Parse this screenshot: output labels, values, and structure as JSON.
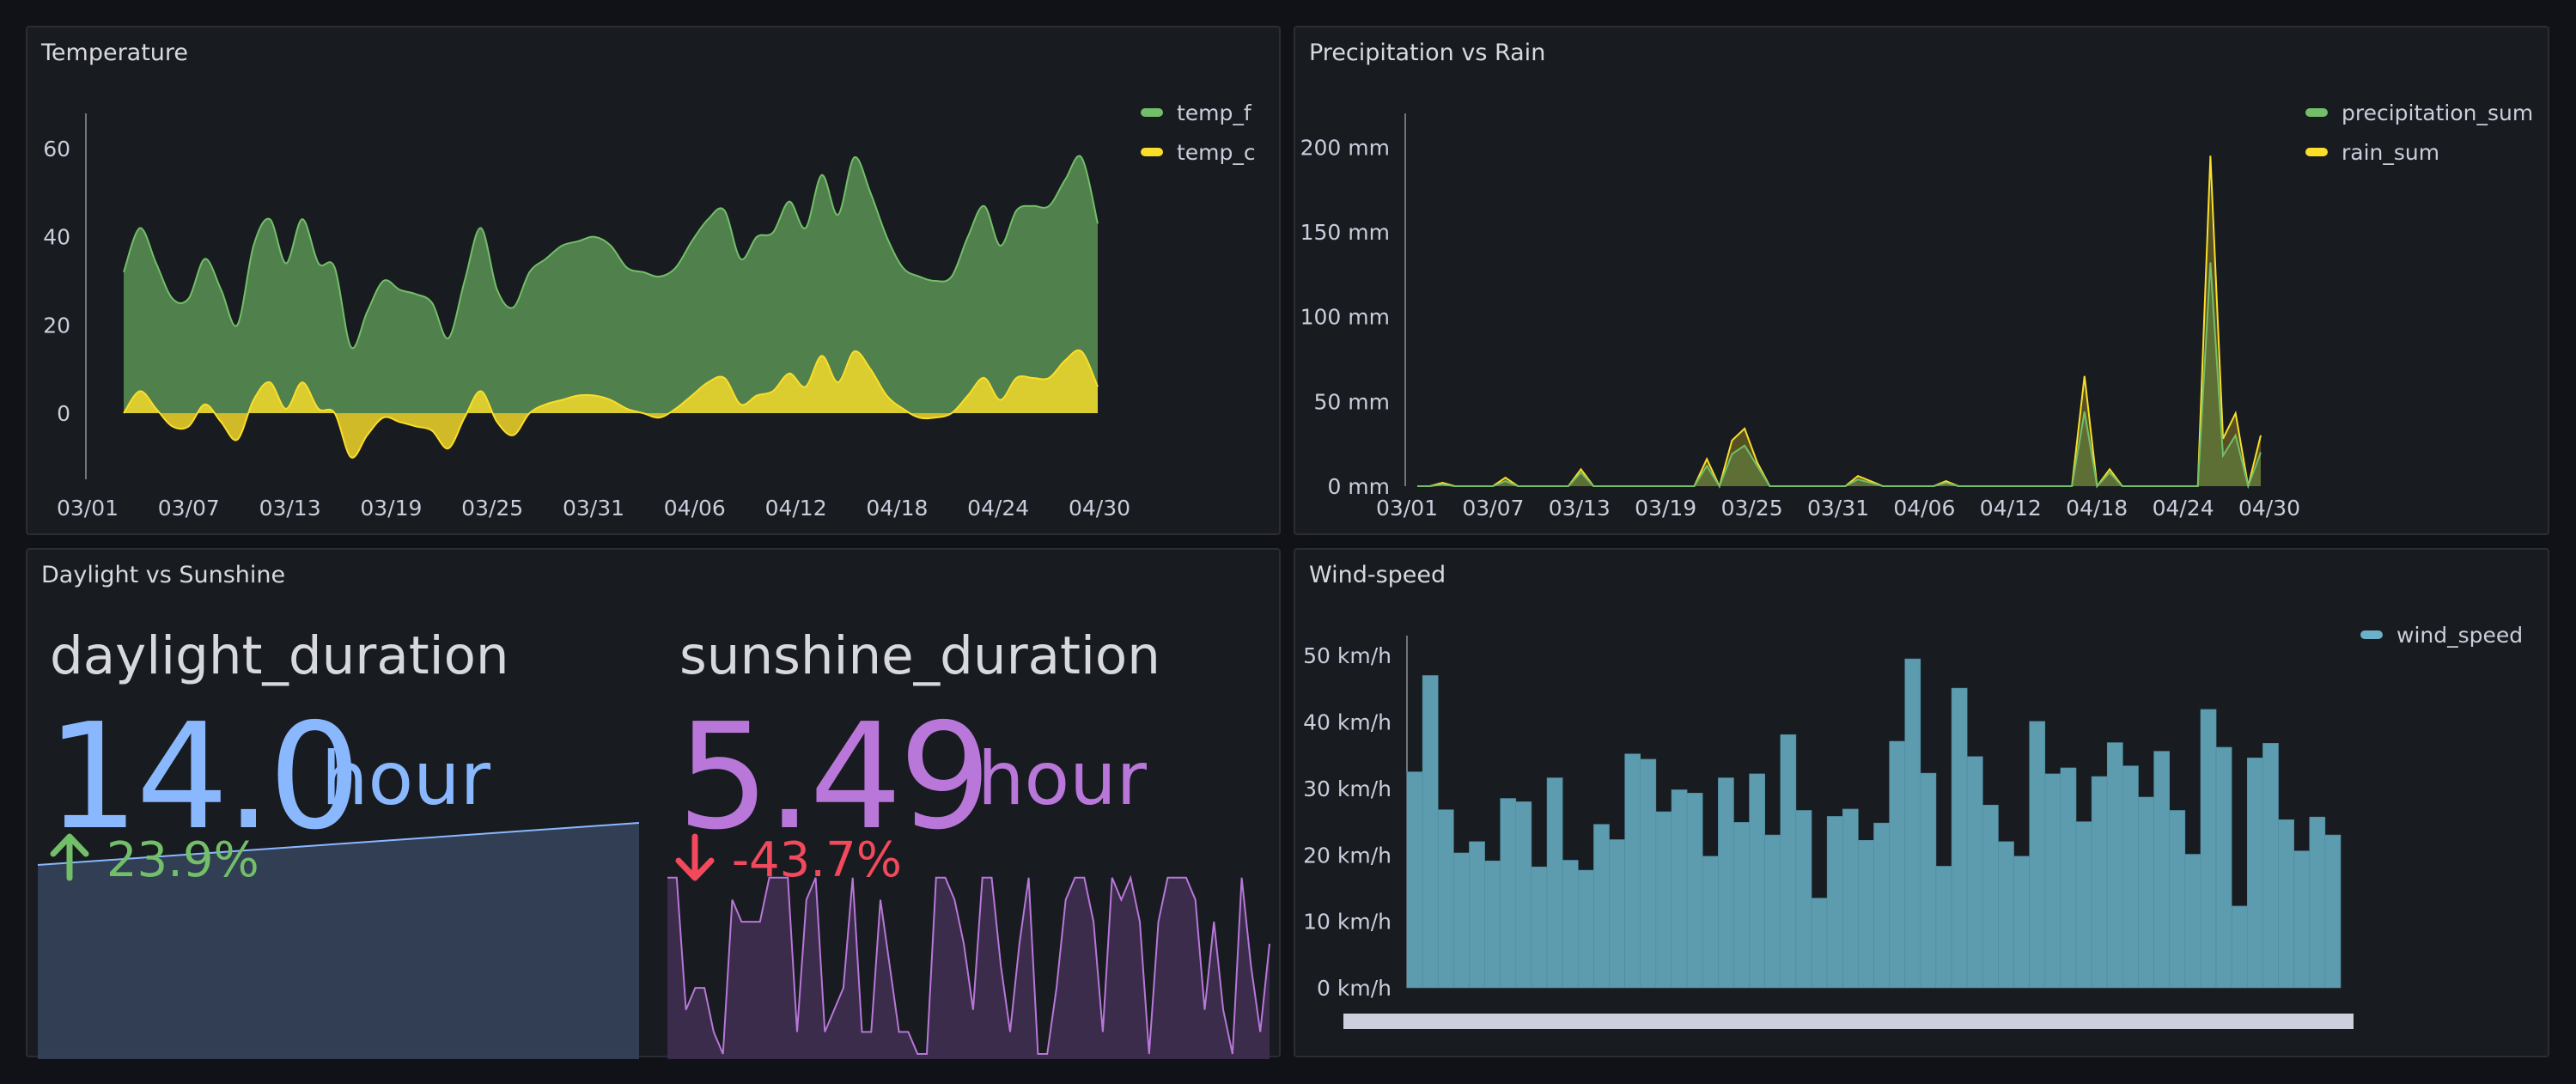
{
  "colors": {
    "green": "#73bf69",
    "yellow": "#fade2a",
    "blue": "#8ab8ff",
    "purple": "#b877d9",
    "red": "#f2495c",
    "wind": "#6ab1c9"
  },
  "temperature": {
    "title": "Temperature",
    "legend": [
      "temp_f",
      "temp_c"
    ],
    "y_ticks": [
      "60",
      "40",
      "20",
      "0"
    ],
    "x_ticks": [
      "03/01",
      "03/07",
      "03/13",
      "03/19",
      "03/25",
      "03/31",
      "04/06",
      "04/12",
      "04/18",
      "04/24",
      "04/30"
    ]
  },
  "precipitation": {
    "title": "Precipitation vs Rain",
    "legend": [
      "precipitation_sum",
      "rain_sum"
    ],
    "y_ticks": [
      "200 mm",
      "150 mm",
      "100 mm",
      "50 mm",
      "0 mm"
    ],
    "x_ticks": [
      "03/01",
      "03/07",
      "03/13",
      "03/19",
      "03/25",
      "03/31",
      "04/06",
      "04/12",
      "04/18",
      "04/24",
      "04/30"
    ]
  },
  "daylight": {
    "title": "Daylight vs Sunshine",
    "daylight_name": "daylight_duration",
    "daylight_value": "14.0",
    "daylight_unit": "hour",
    "daylight_change": "23.9%",
    "sunshine_name": "sunshine_duration",
    "sunshine_value": "5.49",
    "sunshine_unit": "hour",
    "sunshine_change": "-43.7%"
  },
  "wind": {
    "title": "Wind-speed",
    "legend": [
      "wind_speed"
    ],
    "y_ticks": [
      "50 km/h",
      "40 km/h",
      "30 km/h",
      "20 km/h",
      "10 km/h",
      "0 km/h"
    ]
  },
  "chart_data": [
    {
      "type": "area",
      "title": "Temperature",
      "x": [
        "03/01",
        "03/02",
        "03/03",
        "03/04",
        "03/05",
        "03/06",
        "03/07",
        "03/08",
        "03/09",
        "03/10",
        "03/11",
        "03/12",
        "03/13",
        "03/14",
        "03/15",
        "03/16",
        "03/17",
        "03/18",
        "03/19",
        "03/20",
        "03/21",
        "03/22",
        "03/23",
        "03/24",
        "03/25",
        "03/26",
        "03/27",
        "03/28",
        "03/29",
        "03/30",
        "03/31",
        "04/01",
        "04/02",
        "04/03",
        "04/04",
        "04/05",
        "04/06",
        "04/07",
        "04/08",
        "04/09",
        "04/10",
        "04/11",
        "04/12",
        "04/13",
        "04/14",
        "04/15",
        "04/16",
        "04/17",
        "04/18",
        "04/19",
        "04/20",
        "04/21",
        "04/22",
        "04/23",
        "04/24",
        "04/25",
        "04/26",
        "04/27",
        "04/28",
        "04/29",
        "04/30"
      ],
      "ylim": [
        -15,
        68
      ],
      "series": [
        {
          "name": "temp_f",
          "values": [
            32,
            42,
            34,
            26,
            26,
            35,
            28,
            20,
            38,
            44,
            34,
            44,
            34,
            33,
            15,
            23,
            30,
            28,
            27,
            25,
            17,
            30,
            42,
            28,
            24,
            32,
            35,
            38,
            39,
            40,
            38,
            33,
            32,
            31,
            33,
            39,
            44,
            46,
            35,
            40,
            41,
            48,
            42,
            54,
            45,
            58,
            50,
            40,
            33,
            31,
            30,
            31,
            40,
            47,
            38,
            46,
            47,
            47,
            53,
            58,
            43
          ]
        },
        {
          "name": "temp_c",
          "values": [
            0,
            5,
            1,
            -3,
            -3,
            2,
            -2,
            -6,
            3,
            7,
            1,
            7,
            1,
            0,
            -10,
            -5,
            -1,
            -2,
            -3,
            -4,
            -8,
            -1,
            5,
            -2,
            -5,
            0,
            2,
            3,
            4,
            4,
            3,
            1,
            0,
            -1,
            1,
            4,
            7,
            8,
            2,
            4,
            5,
            9,
            6,
            13,
            7,
            14,
            10,
            4,
            1,
            -1,
            -1,
            0,
            4,
            8,
            3,
            8,
            8,
            8,
            12,
            14,
            6
          ]
        }
      ]
    },
    {
      "type": "line",
      "title": "Precipitation vs Rain",
      "x": [
        "03/01",
        "03/02",
        "03/03",
        "03/04",
        "03/05",
        "03/06",
        "03/07",
        "03/08",
        "03/09",
        "03/10",
        "03/11",
        "03/12",
        "03/13",
        "03/14",
        "03/15",
        "03/16",
        "03/17",
        "03/18",
        "03/19",
        "03/20",
        "03/21",
        "03/22",
        "03/23",
        "03/24",
        "03/25",
        "03/26",
        "03/27",
        "03/28",
        "03/29",
        "03/30",
        "03/31",
        "04/01",
        "04/02",
        "04/03",
        "04/04",
        "04/05",
        "04/06",
        "04/07",
        "04/08",
        "04/09",
        "04/10",
        "04/11",
        "04/12",
        "04/13",
        "04/14",
        "04/15",
        "04/16",
        "04/17",
        "04/18",
        "04/19",
        "04/20",
        "04/21",
        "04/22",
        "04/23",
        "04/24",
        "04/25",
        "04/26",
        "04/27",
        "04/28",
        "04/29",
        "04/30"
      ],
      "ylim": [
        0,
        220
      ],
      "series": [
        {
          "name": "precipitation_sum",
          "values": [
            0,
            0,
            1,
            0,
            0,
            0,
            0,
            3,
            0,
            0,
            0,
            0,
            0,
            8,
            0,
            0,
            0,
            0,
            0,
            0,
            0,
            0,
            0,
            12,
            0,
            19,
            24,
            12,
            0,
            0,
            0,
            0,
            0,
            0,
            0,
            4,
            2,
            0,
            0,
            0,
            0,
            0,
            2,
            0,
            0,
            0,
            0,
            0,
            0,
            0,
            0,
            0,
            0,
            44,
            0,
            8,
            0,
            0,
            0,
            0,
            0,
            0,
            0,
            132,
            18,
            30,
            0,
            20
          ]
        },
        {
          "name": "rain_sum",
          "values": [
            0,
            0,
            2,
            0,
            0,
            0,
            0,
            5,
            0,
            0,
            0,
            0,
            0,
            10,
            0,
            0,
            0,
            0,
            0,
            0,
            0,
            0,
            0,
            16,
            0,
            27,
            34,
            14,
            0,
            0,
            0,
            0,
            0,
            0,
            0,
            6,
            3,
            0,
            0,
            0,
            0,
            0,
            3,
            0,
            0,
            0,
            0,
            0,
            0,
            0,
            0,
            0,
            0,
            65,
            0,
            10,
            0,
            0,
            0,
            0,
            0,
            0,
            0,
            195,
            28,
            43,
            0,
            30
          ]
        }
      ]
    },
    {
      "type": "bar",
      "title": "Wind-speed",
      "ylim": [
        0,
        53
      ],
      "series": [
        {
          "name": "wind_speed",
          "values": [
            32.5,
            47,
            26.8,
            20.3,
            22,
            19.1,
            28.5,
            28,
            18.2,
            31.6,
            19.2,
            17.7,
            24.6,
            22.3,
            35.2,
            34.4,
            26.5,
            29.8,
            29.3,
            19.8,
            31.6,
            24.9,
            32.2,
            23,
            38.1,
            26.7,
            13.5,
            25.8,
            26.9,
            22.2,
            24.8,
            37.1,
            49.5,
            32.3,
            18.3,
            45.1,
            34.8,
            27.5,
            22,
            19.8,
            40.1,
            32.2,
            33.1,
            25,
            31.8,
            36.9,
            33.4,
            28.7,
            35.6,
            26.7,
            20.1,
            41.9,
            36.2,
            12.3,
            34.6,
            36.8,
            25.3,
            20.6,
            25.7,
            23
          ]
        }
      ]
    }
  ]
}
